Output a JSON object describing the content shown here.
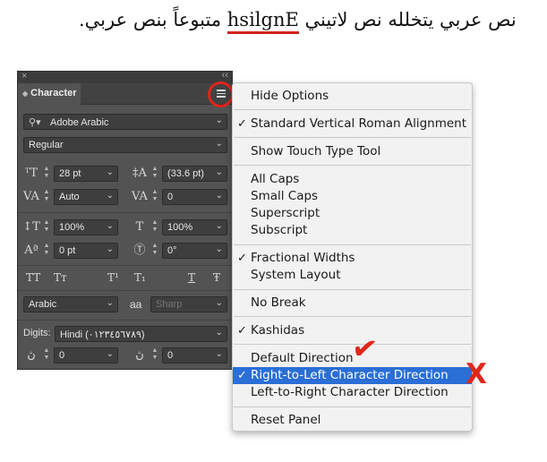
{
  "caption": {
    "before": "نص عربي يتخلله نص لاتيني ",
    "latin": "hsilgnE",
    "after": " متبوعاً بنص عربي."
  },
  "panel": {
    "close_glyph": "×",
    "collapse_glyph": "‹‹",
    "tab_label": "Character",
    "font_family": "Adobe Arabic",
    "font_style": "Regular",
    "font_size": "28 pt",
    "leading": "(33.6 pt)",
    "kerning": "Auto",
    "tracking": "0",
    "vertical_scale": "100%",
    "horizontal_scale": "100%",
    "baseline_shift": "0 pt",
    "character_rotation": "0°",
    "type_buttons": [
      "TT",
      "Tт",
      "T¹",
      "T₁",
      "T",
      "Ŧ"
    ],
    "language": "Arabic",
    "aa_label": "aa",
    "antialias": "Sharp",
    "digits_label": "Digits:",
    "digits_value": "Hindi (٠١٢٣٤٥٦٧٨٩)",
    "diacritic_x": "0",
    "diacritic_y": "0"
  },
  "menu": {
    "items": [
      {
        "label": "Hide Options",
        "checked": false
      },
      {
        "label": "Standard Vertical Roman Alignment",
        "checked": true
      },
      {
        "label": "Show Touch Type Tool",
        "checked": false
      },
      {
        "label": "All Caps",
        "checked": false
      },
      {
        "label": "Small Caps",
        "checked": false
      },
      {
        "label": "Superscript",
        "checked": false
      },
      {
        "label": "Subscript",
        "checked": false
      },
      {
        "label": "Fractional Widths",
        "checked": true
      },
      {
        "label": "System Layout",
        "checked": false
      },
      {
        "label": "No Break",
        "checked": false
      },
      {
        "label": "Kashidas",
        "checked": true
      },
      {
        "label": "Default Direction",
        "checked": false
      },
      {
        "label": "Right-to-Left Character Direction",
        "checked": true,
        "selected": true
      },
      {
        "label": "Left-to-Right Character Direction",
        "checked": false
      },
      {
        "label": "Reset Panel",
        "checked": false
      }
    ],
    "check_glyph": "✓"
  },
  "annotations": {
    "check_mark": "✔",
    "x_mark": "X",
    "color": "#e0281b"
  }
}
